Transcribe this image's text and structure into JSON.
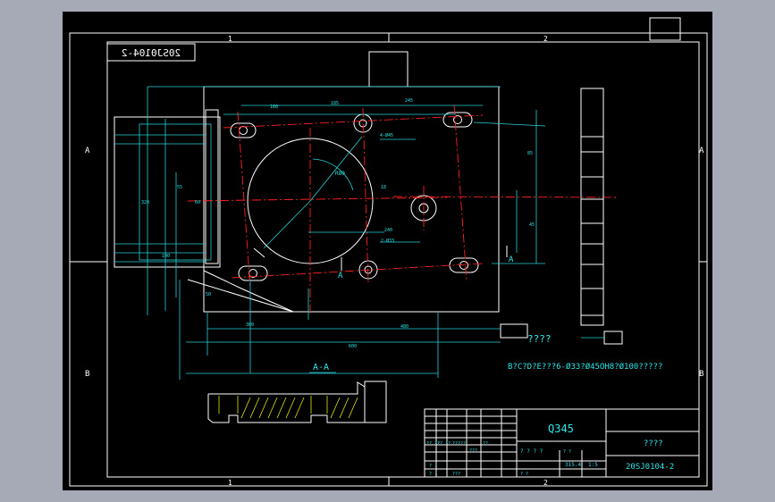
{
  "sheet": {
    "zone_top_1": "1",
    "zone_top_2": "2",
    "zone_bottom_1": "1",
    "zone_bottom_2": "2",
    "zone_left_a": "A",
    "zone_left_b": "B",
    "zone_right_a": "A",
    "zone_right_b": "B"
  },
  "drawing": {
    "mirrored_code": "20SJ0104-2",
    "section_label": "A-A",
    "section_mark_left": "A",
    "section_mark_right": "A",
    "roughness_note": "????",
    "tech_note": "B?C?D?E???6-Ø33?Ø45OH8?Ø100?????"
  },
  "title_block": {
    "material": "Q345",
    "name": "????",
    "code": "20SJ0104-2",
    "scale": "1:5",
    "weight": "315.4",
    "cells": [
      "?? ??",
      "?? ??",
      "?????",
      "??",
      "???",
      "? ?",
      "? ?",
      "? ? ? ?",
      "? ?",
      "? ?",
      "???"
    ]
  },
  "dimensions": {
    "d1": "160",
    "d2": "185",
    "d3": "245",
    "d4": "240",
    "d5": "320",
    "d6": "480",
    "d7": "600",
    "d8": "300",
    "d9": "R80",
    "d10": "85",
    "d11": "45",
    "d12": "2-Ø33",
    "d13": "4-Ø45",
    "d14": "55",
    "d15": "60",
    "d16": "100",
    "d17": "50",
    "d18": "18"
  },
  "colors": {
    "outline": "#ffffff",
    "dimension": "#26d0d6",
    "centerline": "#ff2020",
    "border": "#2fd82f",
    "background": "#000000"
  }
}
